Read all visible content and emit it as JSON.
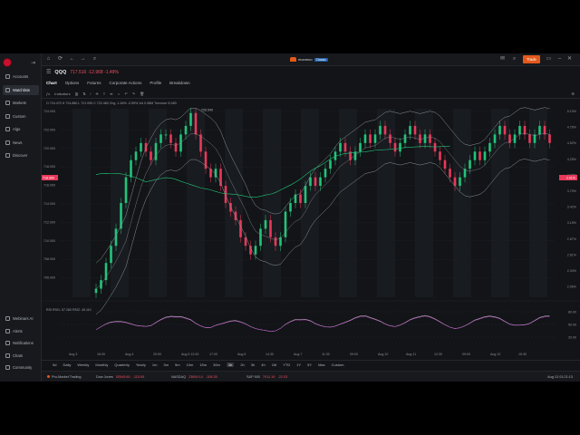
{
  "sidebar": {
    "items": [
      {
        "label": "Accounts",
        "icon": "user-icon"
      },
      {
        "label": "Watchlists",
        "icon": "list-icon"
      },
      {
        "label": "Markets",
        "icon": "globe-icon"
      },
      {
        "label": "Custom",
        "icon": "grid-icon"
      },
      {
        "label": "Algo",
        "icon": "bolt-icon"
      },
      {
        "label": "News",
        "icon": "news-icon"
      },
      {
        "label": "Discover",
        "icon": "compass-icon"
      }
    ],
    "bottom_items": [
      {
        "label": "Webinars AI",
        "icon": "sparkle-icon"
      },
      {
        "label": "Alerts",
        "icon": "bell-icon"
      },
      {
        "label": "Notifications",
        "icon": "inbox-icon"
      },
      {
        "label": "Chats",
        "icon": "chat-icon"
      },
      {
        "label": "Community",
        "icon": "people-icon"
      }
    ]
  },
  "topbar": {
    "brand": "moomoo",
    "brand_tag": "Classic",
    "trade_label": "Trade"
  },
  "symbol": {
    "ticker": "QQQ",
    "price_change": "717.510  -12.968  -1.49%"
  },
  "tabs": [
    "Chart",
    "Options",
    "Futures",
    "Corporate Actions",
    "Profile",
    "Breakdown"
  ],
  "toolbar": {
    "indicators_label": "Indicators"
  },
  "legend": {
    "ohlc": "O 724.470  H 724.880  L 721.090  C 722.460  Chg -1.64%  -0.59%  Vol 0.98M  Turnover 5.04B",
    "rsi": "RSI  RSI1: 57.260  RSI2: 49.110"
  },
  "price_axis": [
    "724.000",
    "722.000",
    "720.000",
    "718.000",
    "716.000",
    "714.000",
    "712.000",
    "710.000",
    "708.000",
    "706.000"
  ],
  "pct_axis": [
    "5.10%",
    "4.76%",
    "4.52%",
    "4.25%",
    "3.98%",
    "3.70%",
    "3.42%",
    "3.15%",
    "2.87%",
    "2.61%",
    "2.34%",
    "2.06%"
  ],
  "current_price_label": "718.960",
  "current_pct_label": "3.91%",
  "peak_label": "726.540",
  "rsi_axis": [
    "80.00",
    "50.00",
    "20.00"
  ],
  "time_axis": [
    "Aug 3",
    "16:00",
    "Aug 4",
    "20:00",
    "Aug 5 12:00",
    "17:00",
    "Aug 6",
    "14:30",
    "Aug 7",
    "11:30",
    "09:00",
    "Aug 10",
    "Aug 11",
    "12:30",
    "09:00",
    "Aug 12",
    "15:30"
  ],
  "timeframes": [
    "5d",
    "Daily",
    "Weekly",
    "Monthly",
    "Quarterly",
    "Yearly",
    "1m",
    "3m",
    "5m",
    "10m",
    "15m",
    "30m",
    "1h",
    "2h",
    "3h",
    "4h",
    "1M",
    "YTD",
    "1Y",
    "5Y",
    "Max",
    "Custom"
  ],
  "active_timeframe": "1h",
  "status": {
    "brand": "Pro-Market Trading",
    "tickers": [
      {
        "name": "Dow Jones",
        "value": "50549.60",
        "change": "-115.95"
      },
      {
        "name": "NASDAQ",
        "value": "23659.14",
        "change": "-108.35"
      },
      {
        "name": "S&P 500",
        "value": "7011.19",
        "change": "-22.03"
      }
    ],
    "clock": "Aug 13 01:21:13"
  },
  "colors": {
    "up": "#22c47a",
    "down": "#e8395a",
    "accent": "#e3591b",
    "bollinger": "#8d9196",
    "ma": "#22c47a",
    "rsi1": "#c9c9c9",
    "rsi2": "#c64bd0"
  }
}
